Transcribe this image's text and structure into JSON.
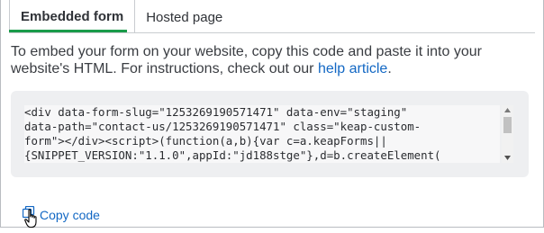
{
  "tabs": [
    {
      "label": "Embedded form",
      "active": true
    },
    {
      "label": "Hosted page",
      "active": false
    }
  ],
  "description": {
    "text": "To embed your form on your website, copy this code and paste it into your website's HTML. For instructions, check out our ",
    "link_label": "help article",
    "suffix": "."
  },
  "code": {
    "lines": [
      "<div data-form-slug=\"1253269190571471\" data-env=\"staging\"",
      "data-path=\"contact-us/1253269190571471\" class=\"keap-custom-",
      "form\"></div><script>(function(a,b){var c=a.keapForms||",
      "{SNIPPET_VERSION:\"1.1.0\",appId:\"jd188stge\"},d=b.createElement("
    ]
  },
  "copy_button": {
    "label": "Copy code",
    "icon": "copy-icon"
  },
  "colors": {
    "accent": "#1a9b4a",
    "link": "#1368c4"
  }
}
